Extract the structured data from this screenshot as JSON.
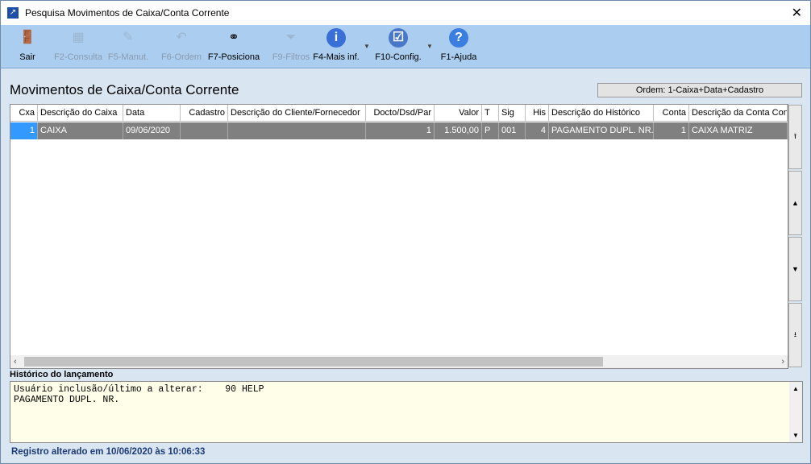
{
  "window": {
    "title": "Pesquisa Movimentos de Caixa/Conta Corrente",
    "close": "✕"
  },
  "toolbar": [
    {
      "label": "Sair",
      "icon": "exit-door-icon",
      "glyph": "🚪",
      "enabled": true
    },
    {
      "label": "F2-Consulta",
      "icon": "grid-search-icon",
      "glyph": "▦",
      "enabled": false
    },
    {
      "label": "F5-Manut.",
      "icon": "edit-pencil-icon",
      "glyph": "✎",
      "enabled": false
    },
    {
      "label": "F6-Ordem",
      "icon": "undo-arrow-icon",
      "glyph": "↶",
      "enabled": false
    },
    {
      "label": "F7-Posiciona",
      "icon": "binoculars-icon",
      "glyph": "⚭",
      "enabled": true
    },
    {
      "label": "F9-Filtros",
      "icon": "funnel-icon",
      "glyph": "⏷",
      "enabled": false
    },
    {
      "label": "F4-Mais inf.",
      "icon": "info-icon",
      "glyph": "i",
      "enabled": true
    },
    {
      "label": "F10-Config.",
      "icon": "checklist-icon",
      "glyph": "☑",
      "enabled": true
    },
    {
      "label": "F1-Ajuda",
      "icon": "help-icon",
      "glyph": "?",
      "enabled": true
    }
  ],
  "heading": "Movimentos de Caixa/Conta Corrente",
  "ordem": "Ordem: 1-Caixa+Data+Cadastro",
  "table": {
    "columns": [
      "Cxa",
      "Descrição do Caixa",
      "Data",
      "Cadastro",
      "Descrição do Cliente/Fornecedor",
      "Docto/Dsd/Par",
      "Valor",
      "T",
      "Sig",
      "His",
      "Descrição do Histórico",
      "Conta",
      "Descrição da Conta Con"
    ],
    "rows": [
      [
        "1",
        "CAIXA",
        "09/06/2020",
        "",
        "",
        "1",
        "1.500,00",
        "P",
        "001",
        "4",
        "PAGAMENTO DUPL. NR.",
        "1",
        "CAIXA MATRIZ"
      ]
    ]
  },
  "history": {
    "label": "Histórico do lançamento",
    "line1": "Usuário inclusão/último a alterar:    90 HELP",
    "line2": "PAGAMENTO DUPL. NR."
  },
  "status": "Registro alterado em 10/06/2020 às 10:06:33"
}
